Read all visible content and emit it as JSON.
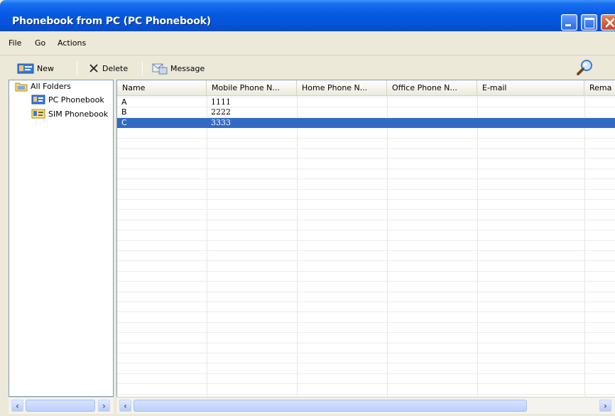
{
  "window": {
    "title": "Phonebook from PC  (PC Phonebook)"
  },
  "menu": {
    "items": [
      {
        "label": "File"
      },
      {
        "label": "Go"
      },
      {
        "label": "Actions"
      }
    ]
  },
  "toolbar": {
    "new_label": "New",
    "delete_label": "Delete",
    "message_label": "Message"
  },
  "folders": {
    "root": "All Folders",
    "items": [
      {
        "label": "PC Phonebook",
        "icon": "phonebook-icon"
      },
      {
        "label": "SIM Phonebook",
        "icon": "sim-card-icon"
      }
    ]
  },
  "list": {
    "columns": [
      "Name",
      "Mobile Phone N...",
      "Home Phone N...",
      "Office Phone N...",
      "E-mail",
      "Rema"
    ],
    "rows": [
      {
        "name": "A",
        "mobile": "1111",
        "home": "",
        "office": "",
        "email": "",
        "remark": ""
      },
      {
        "name": "B",
        "mobile": "2222",
        "home": "",
        "office": "",
        "email": "",
        "remark": ""
      },
      {
        "name": "C",
        "mobile": "3333",
        "home": "",
        "office": "",
        "email": "",
        "remark": ""
      }
    ],
    "selected_row": 2
  },
  "colors": {
    "title_bar": "#0553d8",
    "selection": "#316ac5",
    "window_face": "#ece9d8"
  }
}
